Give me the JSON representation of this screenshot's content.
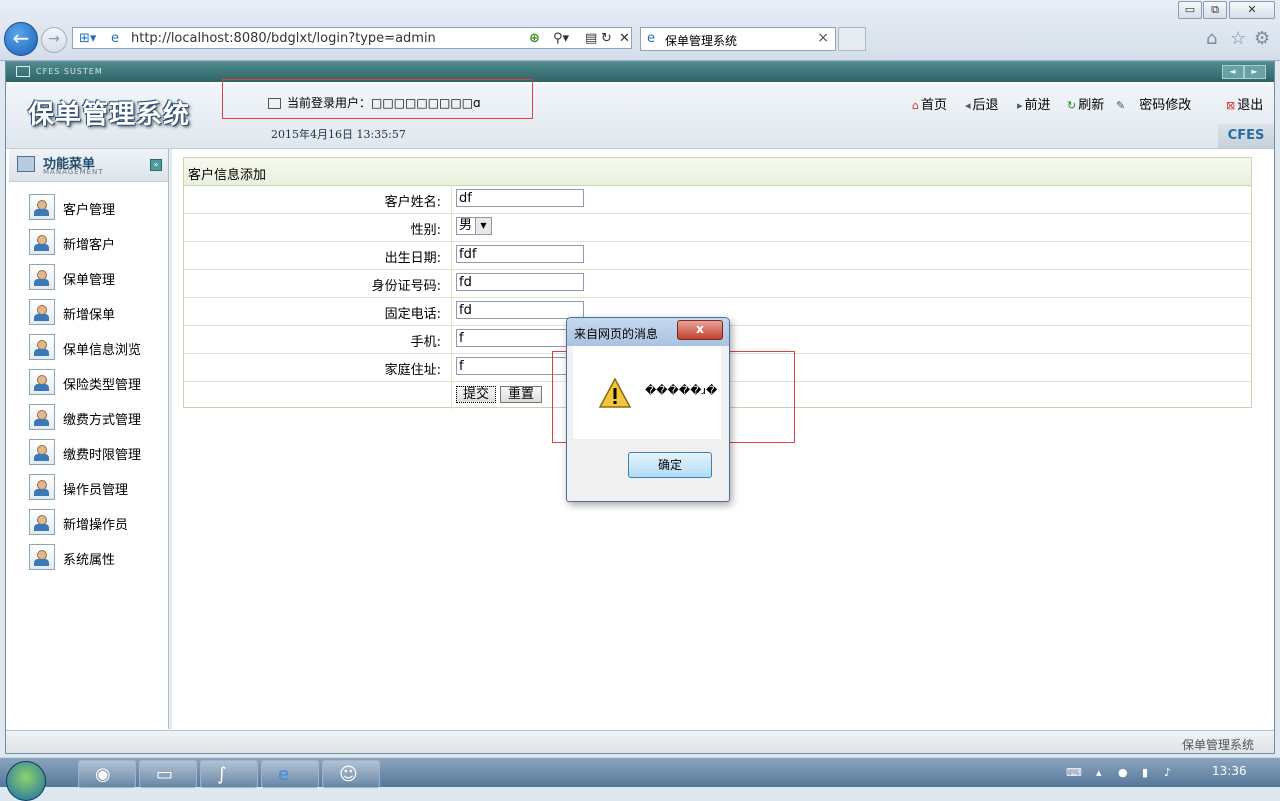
{
  "browser": {
    "url": "http://localhost:8080/bdglxt/login?type=admin",
    "tab_title": "保单管理系统",
    "tab_close": "×",
    "minimize": "▭",
    "maximize": "⧉",
    "close": "✕"
  },
  "app": {
    "system_label": "CFES SUSTEM",
    "title": "保单管理系统",
    "current_user_label": "当前登录用户：",
    "current_user_value": "□□□□□□□□□ɑ",
    "date_text": "2015年4月16日  13:35:57",
    "brand": "CFES",
    "top_nav": {
      "home": "首页",
      "back": "后退",
      "forward": "前进",
      "refresh": "刷新",
      "change_password": "密码修改",
      "logout": "退出"
    },
    "status_text": "保单管理系统"
  },
  "sidebar": {
    "title": "功能菜单",
    "subtitle": "MANAGEMENT",
    "items": [
      {
        "label": "客户管理"
      },
      {
        "label": "新增客户"
      },
      {
        "label": "保单管理"
      },
      {
        "label": "新增保单"
      },
      {
        "label": "保单信息浏览"
      },
      {
        "label": "保险类型管理"
      },
      {
        "label": "缴费方式管理"
      },
      {
        "label": "缴费时限管理"
      },
      {
        "label": "操作员管理"
      },
      {
        "label": "新增操作员"
      },
      {
        "label": "系统属性"
      }
    ]
  },
  "form": {
    "title": "客户信息添加",
    "fields": [
      {
        "label": "客户姓名:",
        "value": "df"
      },
      {
        "label": "性别:",
        "value": "男"
      },
      {
        "label": "出生日期:",
        "value": "fdf"
      },
      {
        "label": "身份证号码:",
        "value": "fd"
      },
      {
        "label": "固定电话:",
        "value": "fd"
      },
      {
        "label": "手机:",
        "value": "f"
      },
      {
        "label": "家庭住址:",
        "value": "f"
      }
    ],
    "submit_label": "提交",
    "reset_label": "重置"
  },
  "dialog": {
    "title": "来自网页的消息",
    "close_label": "x",
    "message": "�����ɹ�",
    "ok_label": "确定"
  },
  "taskbar": {
    "clock": "13:36"
  }
}
